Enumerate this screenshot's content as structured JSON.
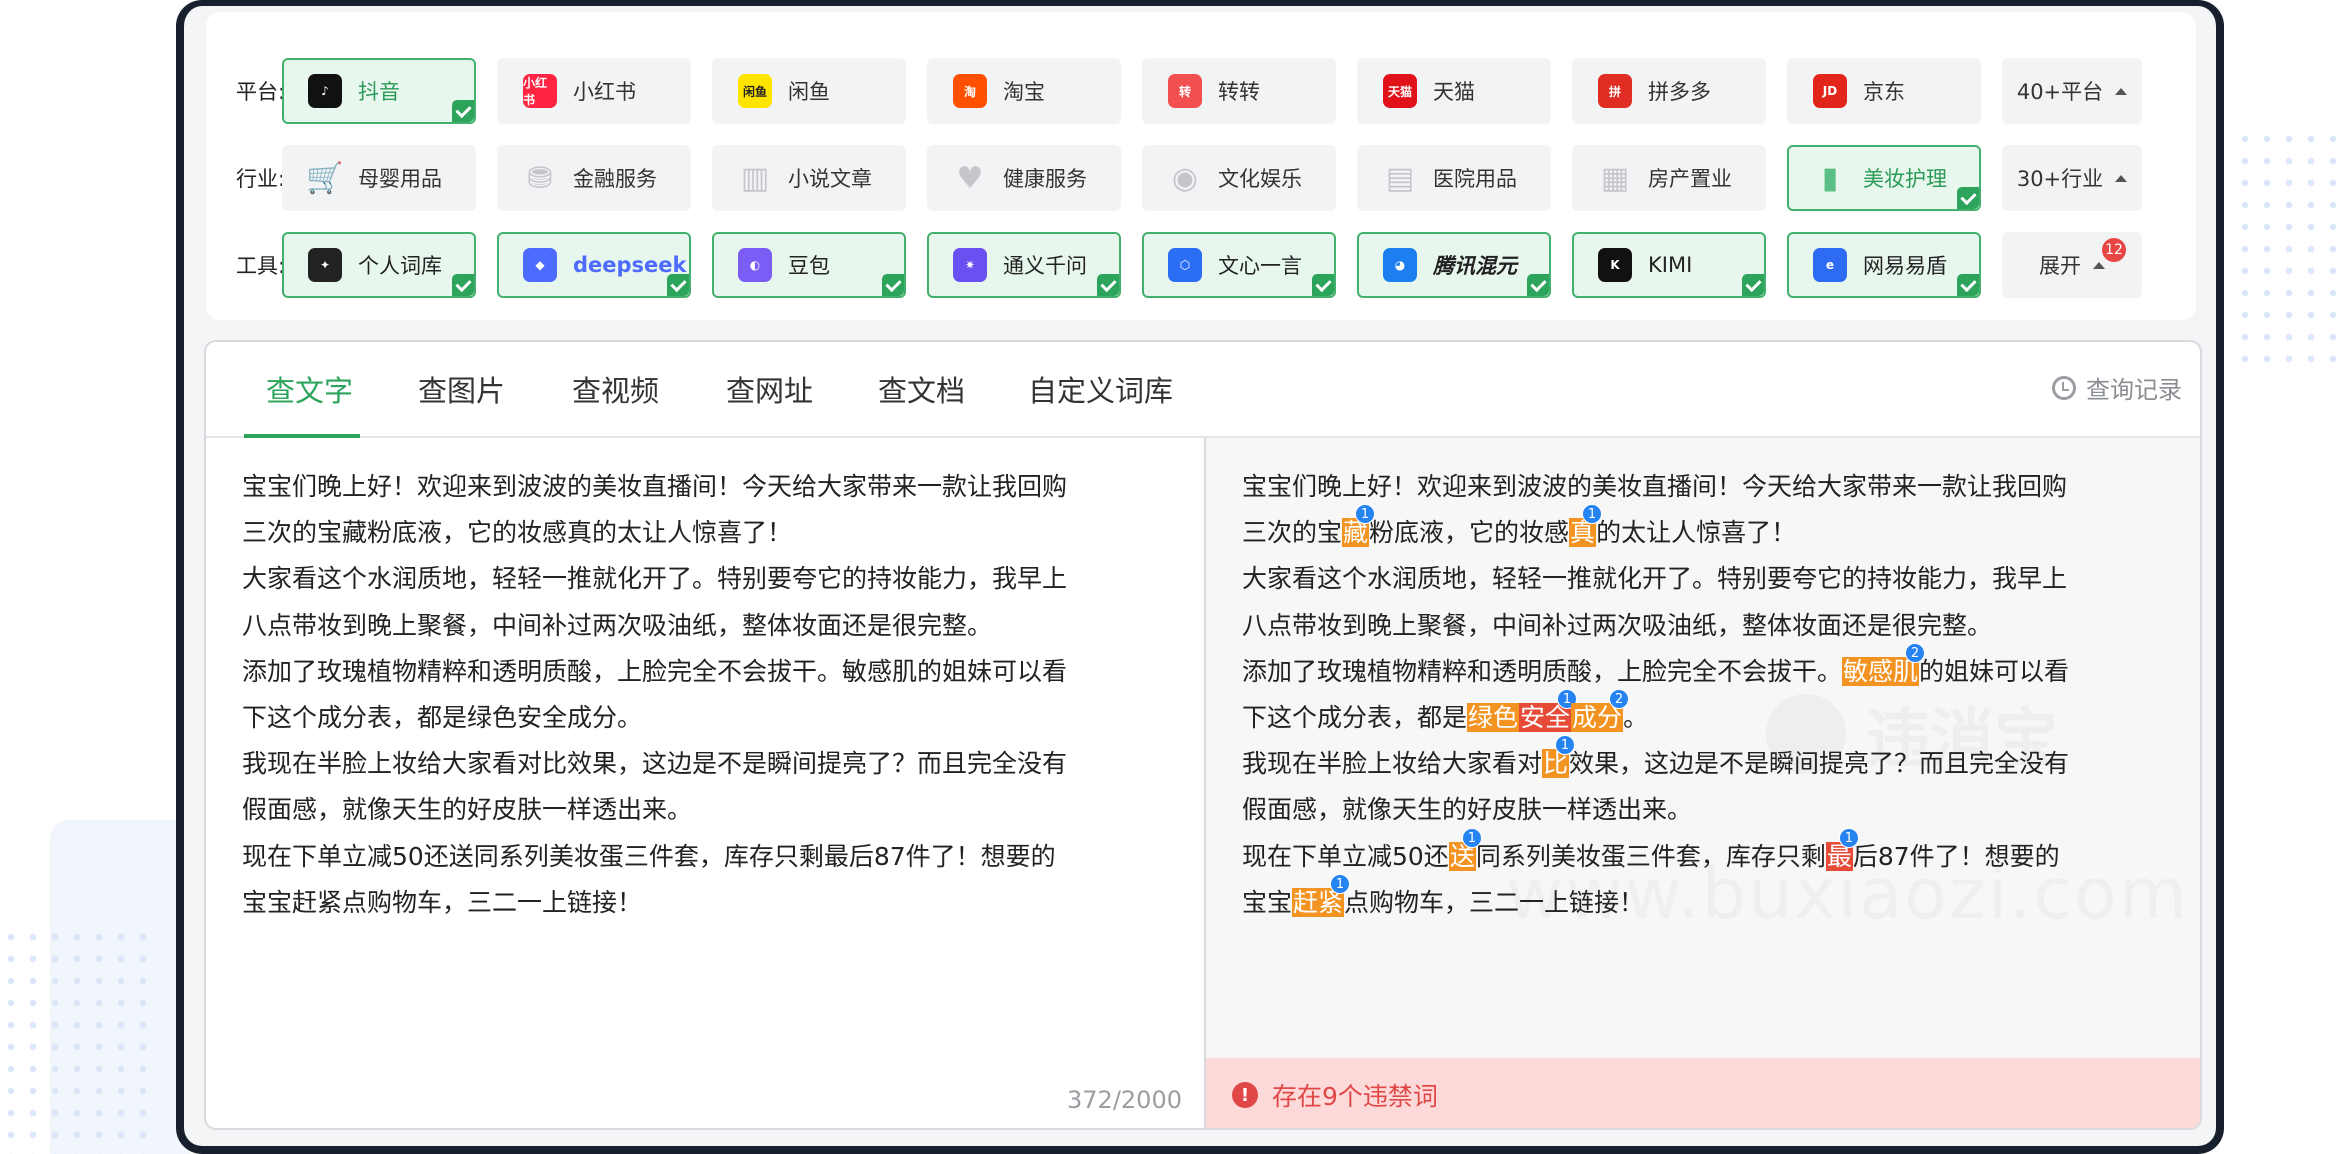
{
  "platform_row": {
    "label": "平台:",
    "chips": [
      {
        "label": "抖音",
        "selected": true,
        "icon": "douyin-icon",
        "color": "#111111",
        "glyph": "♪"
      },
      {
        "label": "小红书",
        "selected": false,
        "icon": "xiaohongshu-icon",
        "color": "#ff2442",
        "glyph": "小红书"
      },
      {
        "label": "闲鱼",
        "selected": false,
        "icon": "xianyu-icon",
        "color": "#ffe400",
        "glyph": "闲鱼"
      },
      {
        "label": "淘宝",
        "selected": false,
        "icon": "taobao-icon",
        "color": "#ff5000",
        "glyph": "淘"
      },
      {
        "label": "转转",
        "selected": false,
        "icon": "zhuanzhuan-icon",
        "color": "#f25050",
        "glyph": "转"
      },
      {
        "label": "天猫",
        "selected": false,
        "icon": "tmall-icon",
        "color": "#e1111a",
        "glyph": "天猫"
      },
      {
        "label": "拼多多",
        "selected": false,
        "icon": "pinduoduo-icon",
        "color": "#e02e24",
        "glyph": "拼"
      },
      {
        "label": "京东",
        "selected": false,
        "icon": "jd-icon",
        "color": "#e1251b",
        "glyph": "JD"
      }
    ],
    "more_label": "40+平台"
  },
  "industry_row": {
    "label": "行业:",
    "chips": [
      {
        "label": "母婴用品",
        "selected": false,
        "icon": "stroller-icon"
      },
      {
        "label": "金融服务",
        "selected": false,
        "icon": "coins-icon"
      },
      {
        "label": "小说文章",
        "selected": false,
        "icon": "book-icon"
      },
      {
        "label": "健康服务",
        "selected": false,
        "icon": "heart-hand-icon"
      },
      {
        "label": "文化娱乐",
        "selected": false,
        "icon": "music-disc-icon"
      },
      {
        "label": "医院用品",
        "selected": false,
        "icon": "hospital-icon"
      },
      {
        "label": "房产置业",
        "selected": false,
        "icon": "building-icon"
      },
      {
        "label": "美妆护理",
        "selected": true,
        "icon": "cosmetics-icon"
      }
    ],
    "more_label": "30+行业"
  },
  "tool_row": {
    "label": "工具:",
    "chips": [
      {
        "label": "个人词库",
        "selected": true,
        "icon": "personal-lexicon-icon",
        "color": "#222222",
        "glyph": "✦"
      },
      {
        "label": "deepseek",
        "selected": true,
        "icon": "deepseek-icon",
        "color": "#4d6bfe",
        "glyph": "◆"
      },
      {
        "label": "豆包",
        "selected": true,
        "icon": "doubao-icon",
        "color": "#7b5cf5",
        "glyph": "◐"
      },
      {
        "label": "通义千问",
        "selected": true,
        "icon": "tongyi-icon",
        "color": "#6950f0",
        "glyph": "✷"
      },
      {
        "label": "文心一言",
        "selected": true,
        "icon": "wenxin-icon",
        "color": "#2b6ef5",
        "glyph": "⬡"
      },
      {
        "label": "腾讯混元",
        "selected": true,
        "icon": "hunyuan-icon",
        "color": "#1d7ef0",
        "glyph": "◕"
      },
      {
        "label": "KIMI",
        "selected": true,
        "icon": "kimi-icon",
        "color": "#111111",
        "glyph": "K"
      },
      {
        "label": "网易易盾",
        "selected": true,
        "icon": "yidun-icon",
        "color": "#2d6bf2",
        "glyph": "e"
      }
    ],
    "more_label": "展开",
    "notif_count": "12"
  },
  "tabs": [
    "查文字",
    "查图片",
    "查视频",
    "查网址",
    "查文档",
    "自定义词库"
  ],
  "active_tab": "查文字",
  "history_label": "查询记录",
  "input_text": "宝宝们晚上好！欢迎来到波波的美妆直播间！今天给大家带来一款让我回购\n三次的宝藏粉底液，它的妆感真的太让人惊喜了！\n大家看这个水润质地，轻轻一推就化开了。特别要夸它的持妆能力，我早上\n八点带妆到晚上聚餐，中间补过两次吸油纸，整体妆面还是很完整。\n添加了玫瑰植物精粹和透明质酸，上脸完全不会拔干。敏感肌的姐妹可以看\n下这个成分表，都是绿色安全成分。\n我现在半脸上妆给大家看对比效果，这边是不是瞬间提亮了？而且完全没有\n假面感，就像天生的好皮肤一样透出来。\n现在下单立减50还送同系列美妆蛋三件套，库存只剩最后87件了！想要的\n宝宝赶紧点购物车，三二一上链接！",
  "char_count": "372/2000",
  "result_segments": [
    {
      "t": "宝宝们晚上好！欢迎来到波波的美妆直播间！今天给大家带来一款让我回购\n三次的宝"
    },
    {
      "t": "藏",
      "hl": "orange",
      "n": "1"
    },
    {
      "t": "粉底液，它的妆感"
    },
    {
      "t": "真",
      "hl": "orange",
      "n": "1"
    },
    {
      "t": "的太让人惊喜了！\n大家看这个水润质地，轻轻一推就化开了。特别要夸它的持妆能力，我早上\n八点带妆到晚上聚餐，中间补过两次吸油纸，整体妆面还是很完整。\n添加了玫瑰植物精粹和透明质酸，上脸完全不会拔干。"
    },
    {
      "t": "敏感肌",
      "hl": "orange",
      "n": "2"
    },
    {
      "t": "的姐妹可以看\n下这个成分表，都是"
    },
    {
      "t": "绿色",
      "hl": "orange"
    },
    {
      "t": "安全",
      "hl": "red",
      "n": "1"
    },
    {
      "t": "成分",
      "hl": "orange",
      "n": "2"
    },
    {
      "t": "。\n我现在半脸上妆给大家看对"
    },
    {
      "t": "比",
      "hl": "orange",
      "n": "1"
    },
    {
      "t": "效果，这边是不是瞬间提亮了？而且完全没有\n假面感，就像天生的好皮肤一样透出来。\n现在下单立减50还"
    },
    {
      "t": "送",
      "hl": "orange",
      "n": "1"
    },
    {
      "t": "同系列美妆蛋三件套，库存只剩"
    },
    {
      "t": "最",
      "hl": "red",
      "n": "1"
    },
    {
      "t": "后87件了！想要的\n宝宝"
    },
    {
      "t": "赶紧",
      "hl": "orange",
      "n": "1"
    },
    {
      "t": "点购物车，三二一上链接！"
    }
  ],
  "alert_text": "存在9个违禁词",
  "watermark_text": "违消宝",
  "watermark_url": "www.buxiaozi.com"
}
